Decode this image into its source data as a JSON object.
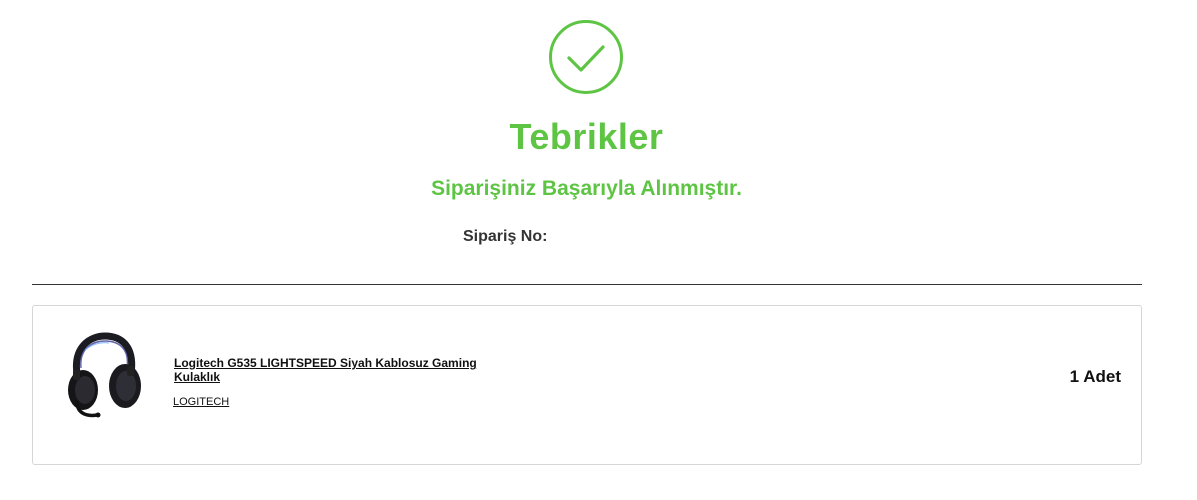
{
  "success": {
    "icon": "checkmark-circle-icon",
    "title": "Tebrikler",
    "subtitle": "Siparişiniz Başarıyla Alınmıştır.",
    "order_label": "Sipariş No:",
    "accent_color": "#5ec544"
  },
  "order_items": [
    {
      "image": "headset-image",
      "name": "Logitech G535 LIGHTSPEED Siyah Kablosuz Gaming Kulaklık",
      "brand": "LOGITECH",
      "quantity": "1 Adet"
    }
  ]
}
